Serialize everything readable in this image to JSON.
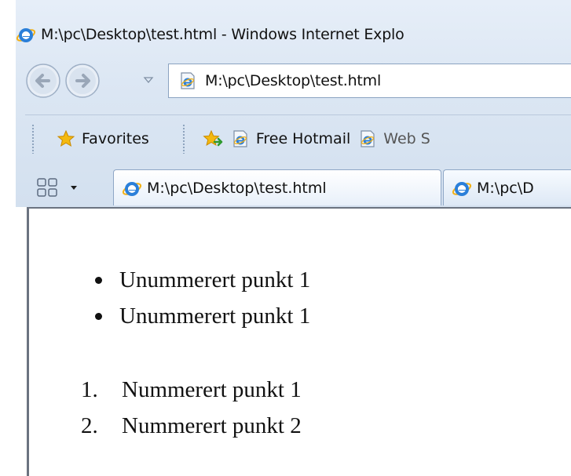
{
  "window": {
    "title": "M:\\pc\\Desktop\\test.html - Windows Internet Explo"
  },
  "nav": {
    "address": "M:\\pc\\Desktop\\test.html"
  },
  "favorites": {
    "favorites_label": "Favorites",
    "links": [
      {
        "label": "Free Hotmail",
        "icon": "ie-page-icon"
      },
      {
        "label": "Web S",
        "icon": "ie-page-icon"
      }
    ]
  },
  "tabs": [
    {
      "label": "M:\\pc\\Desktop\\test.html",
      "icon": "ie-logo-icon"
    },
    {
      "label": "M:\\pc\\D",
      "icon": "ie-logo-icon"
    }
  ],
  "content": {
    "unordered": [
      "Unummerert punkt 1",
      "Unummerert punkt 1"
    ],
    "ordered": [
      {
        "number": "1.",
        "text": "Nummerert punkt 1"
      },
      {
        "number": "2.",
        "text": "Nummerert punkt 2"
      }
    ]
  },
  "colors": {
    "chrome": "#dbe6f3",
    "content_border": "#6b7380",
    "ie_blue": "#1f73d1",
    "star_gold": "#f4b90f"
  }
}
